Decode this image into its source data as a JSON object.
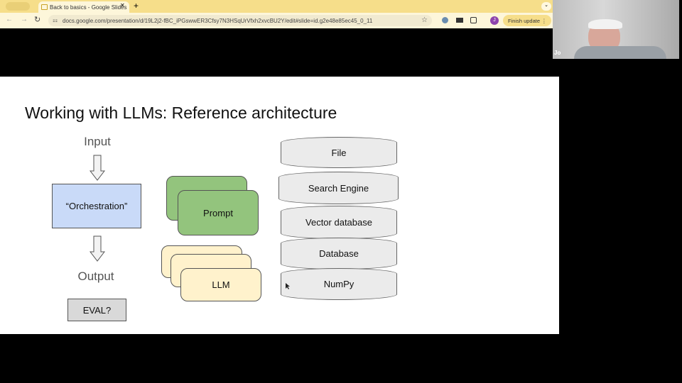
{
  "browser": {
    "tab_title": "Back to basics - Google Slides",
    "url": "docs.google.com/presentation/d/19L2j2-fBC_iPGswwER3Cfsy7N3HSqUrVfxh2xvcBU2Y/edit#slide=id.g2e48e85ec45_0_11",
    "new_tab": "+",
    "close": "✕",
    "profile_initial": "J",
    "finish_update": "Finish update"
  },
  "video": {
    "participant_name": "Jo"
  },
  "slide": {
    "title": "Working with LLMs: Reference architecture",
    "input": "Input",
    "orchestration": "“Orchestration”",
    "output": "Output",
    "eval": "EVAL?",
    "prompt": "Prompt",
    "llm": "LLM",
    "stores": [
      "File",
      "Search Engine",
      "Vector database",
      "Database",
      "NumPy"
    ]
  },
  "colors": {
    "orchestration": "#c9daf8",
    "prompt": "#93c47d",
    "llm": "#fff2cc",
    "eval": "#d9d9d9",
    "tabbar": "#f6de8a"
  }
}
